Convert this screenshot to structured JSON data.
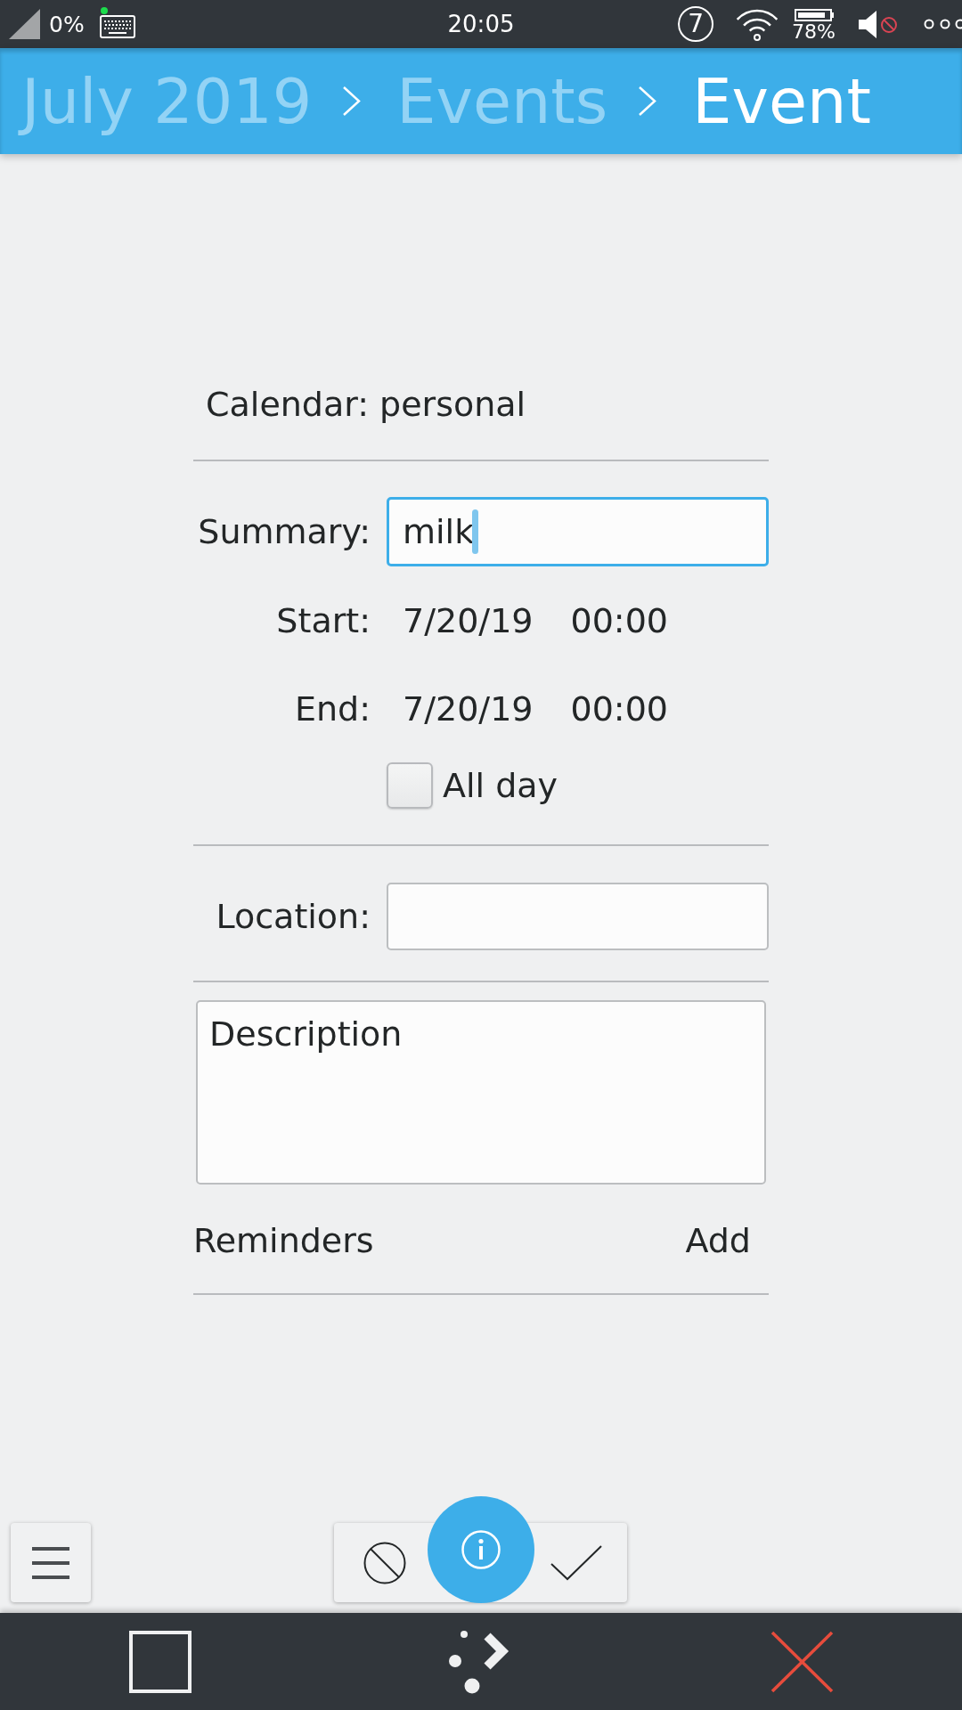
{
  "status_bar": {
    "signal": "0%",
    "time": "20:05",
    "notifications": "7",
    "battery": "78%"
  },
  "header": {
    "breadcrumbs": [
      {
        "label": "July 2019",
        "selected": false
      },
      {
        "label": "Events",
        "selected": false
      },
      {
        "label": "Event",
        "selected": true
      }
    ]
  },
  "form": {
    "calendar": "Calendar: personal",
    "summary": {
      "label": "Summary:",
      "value": "milk",
      "focused": true
    },
    "times": [
      {
        "label": "Start:",
        "date": "7/20/19",
        "time": "00:00"
      },
      {
        "label": "End:",
        "date": "7/20/19",
        "time": "00:00"
      }
    ],
    "all_day": {
      "label": "All day",
      "checked": false
    },
    "location": {
      "label": "Location:",
      "focused": false
    },
    "description": {
      "placeholder": "Description",
      "focused": false
    },
    "reminders": {
      "label": "Reminders",
      "button": "Add"
    }
  }
}
